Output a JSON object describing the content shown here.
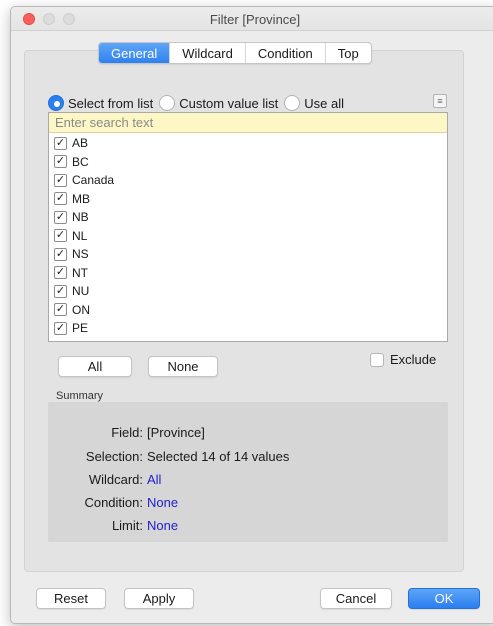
{
  "window": {
    "title": "Filter [Province]"
  },
  "tabs": [
    {
      "label": "General",
      "active": true
    },
    {
      "label": "Wildcard",
      "active": false
    },
    {
      "label": "Condition",
      "active": false
    },
    {
      "label": "Top",
      "active": false
    }
  ],
  "mode": {
    "options": [
      {
        "label": "Select from list",
        "selected": true
      },
      {
        "label": "Custom value list",
        "selected": false
      },
      {
        "label": "Use all",
        "selected": false
      }
    ],
    "menu_icon": "list-menu-icon"
  },
  "list": {
    "search_placeholder": "Enter search text",
    "items": [
      {
        "label": "AB",
        "checked": true
      },
      {
        "label": "BC",
        "checked": true
      },
      {
        "label": "Canada",
        "checked": true
      },
      {
        "label": "MB",
        "checked": true
      },
      {
        "label": "NB",
        "checked": true
      },
      {
        "label": "NL",
        "checked": true
      },
      {
        "label": "NS",
        "checked": true
      },
      {
        "label": "NT",
        "checked": true
      },
      {
        "label": "NU",
        "checked": true
      },
      {
        "label": "ON",
        "checked": true
      },
      {
        "label": "PE",
        "checked": true
      }
    ]
  },
  "list_buttons": {
    "all": "All",
    "none": "None"
  },
  "exclude": {
    "label": "Exclude",
    "checked": false
  },
  "summary": {
    "heading": "Summary",
    "field_label": "Field:",
    "field_value": "[Province]",
    "selection_label": "Selection:",
    "selection_value": "Selected 14 of 14 values",
    "wildcard_label": "Wildcard:",
    "wildcard_value": "All",
    "condition_label": "Condition:",
    "condition_value": "None",
    "limit_label": "Limit:",
    "limit_value": "None"
  },
  "footer": {
    "reset": "Reset",
    "apply": "Apply",
    "cancel": "Cancel",
    "ok": "OK"
  },
  "colors": {
    "accent": "#2a7ef0",
    "link": "#1f22c9",
    "search_bg": "#fdf7c6"
  }
}
